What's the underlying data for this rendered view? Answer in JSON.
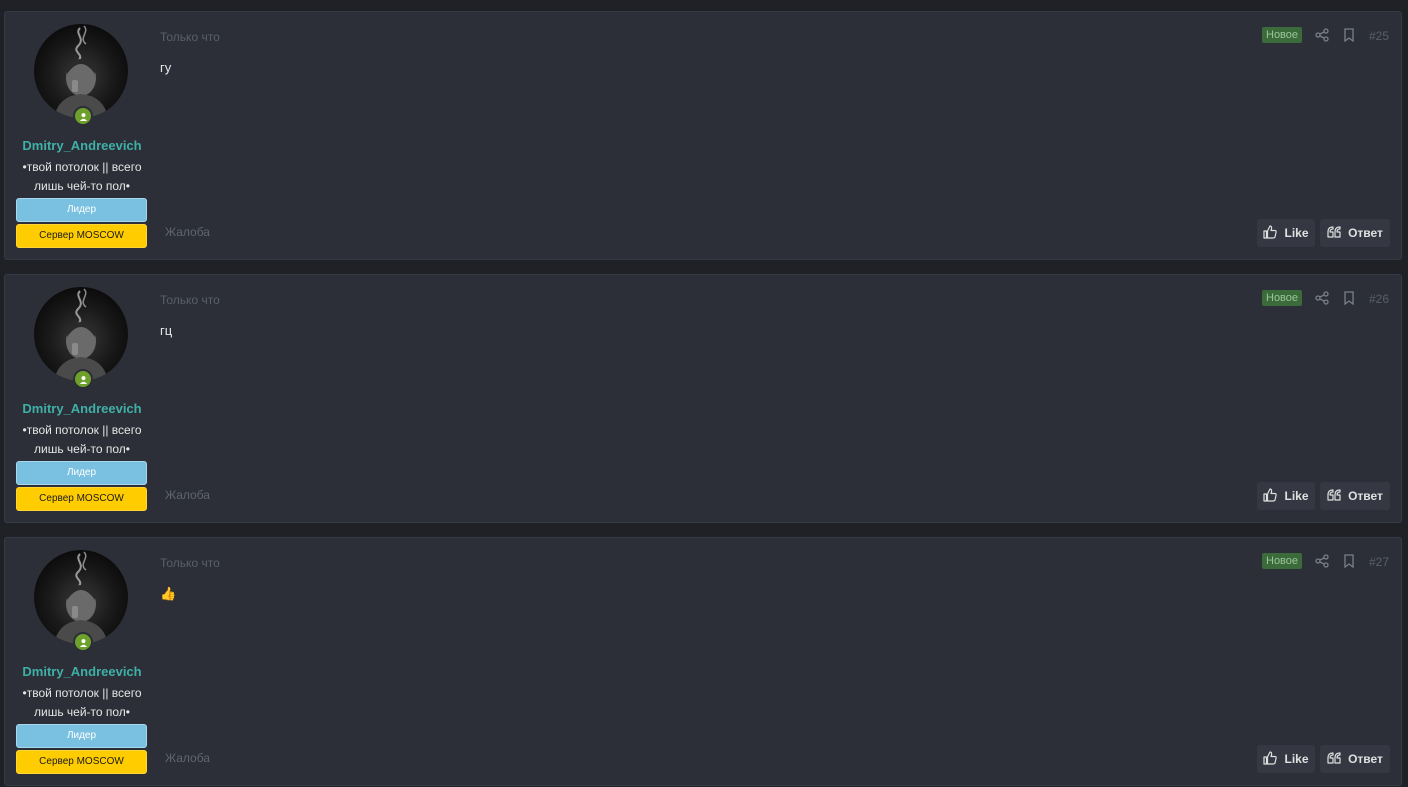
{
  "posts": [
    {
      "username": "Dmitry_Andreevich",
      "user_title": "•твой потолок || всего лишь чей-то пол•",
      "banner_role": "Лидер",
      "banner_server": "Сервер MOSCOW",
      "timestamp": "Только что",
      "message": "гу",
      "badge": "Новое",
      "number": "#25",
      "report": "Жалоба",
      "like_label": "Like",
      "reply_label": "Ответ"
    },
    {
      "username": "Dmitry_Andreevich",
      "user_title": "•твой потолок || всего лишь чей-то пол•",
      "banner_role": "Лидер",
      "banner_server": "Сервер MOSCOW",
      "timestamp": "Только что",
      "message": "гц",
      "badge": "Новое",
      "number": "#26",
      "report": "Жалоба",
      "like_label": "Like",
      "reply_label": "Ответ"
    },
    {
      "username": "Dmitry_Andreevich",
      "user_title": "•твой потолок || всего лишь чей-то пол•",
      "banner_role": "Лидер",
      "banner_server": "Сервер MOSCOW",
      "timestamp": "Только что",
      "message": "👍",
      "badge": "Новое",
      "number": "#27",
      "report": "Жалоба",
      "like_label": "Like",
      "reply_label": "Ответ"
    }
  ],
  "colors": {
    "username": "#3fb0a7",
    "banner_role": "#7ac0e0",
    "banner_server": "#ffcc00",
    "badge_new": "#3b6a3b",
    "online": "#6ea12b"
  },
  "icons": [
    "online-status-icon",
    "share-icon",
    "bookmark-icon",
    "thumbs-up-icon",
    "quote-icon"
  ]
}
